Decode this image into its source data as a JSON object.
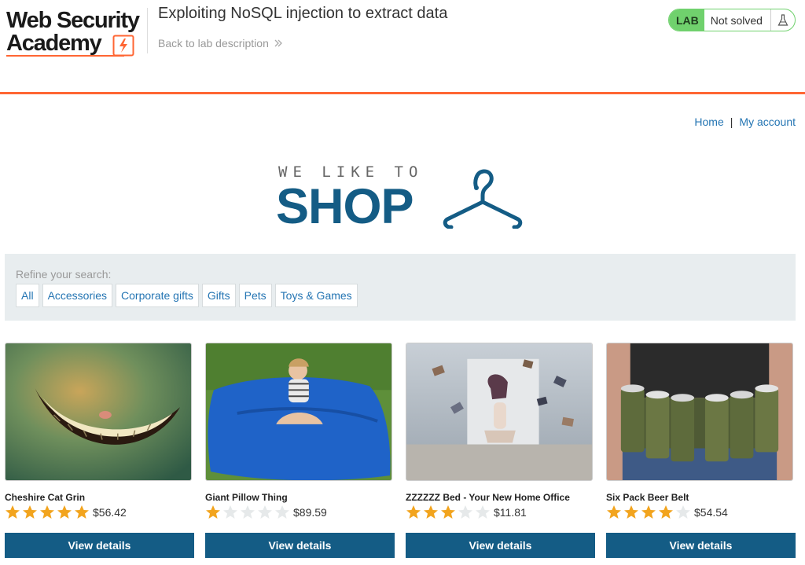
{
  "academy": {
    "logo_line1": "Web Security",
    "logo_line2": "Academy",
    "lab_title": "Exploiting NoSQL injection to extract data",
    "back_link": "Back to lab description",
    "lab_badge": "LAB",
    "lab_status": "Not solved"
  },
  "nav": {
    "home": "Home",
    "separator": "|",
    "my_account": "My account"
  },
  "shop_logo": {
    "tagline": "WE LIKE TO",
    "word": "SHOP"
  },
  "filters": {
    "label": "Refine your search:",
    "items": [
      "All",
      "Accessories",
      "Corporate gifts",
      "Gifts",
      "Pets",
      "Toys & Games"
    ]
  },
  "products": [
    {
      "name": "Cheshire Cat Grin",
      "rating": 5,
      "price": "$56.42",
      "button": "View details",
      "image_icon": "cheshire-grin-image"
    },
    {
      "name": "Giant Pillow Thing",
      "rating": 1,
      "price": "$89.59",
      "button": "View details",
      "image_icon": "blue-beanbag-image"
    },
    {
      "name": "ZZZZZZ Bed - Your New Home Office",
      "rating": 3,
      "price": "$11.81",
      "button": "View details",
      "image_icon": "flying-books-bed-image"
    },
    {
      "name": "Six Pack Beer Belt",
      "rating": 4,
      "price": "$54.54",
      "button": "View details",
      "image_icon": "beer-belt-image"
    }
  ],
  "colors": {
    "accent_orange": "#ff6633",
    "lab_green": "#70d16d",
    "shop_blue": "#145c85",
    "link_blue": "#2475b3",
    "star_gold": "#f2a41e"
  }
}
